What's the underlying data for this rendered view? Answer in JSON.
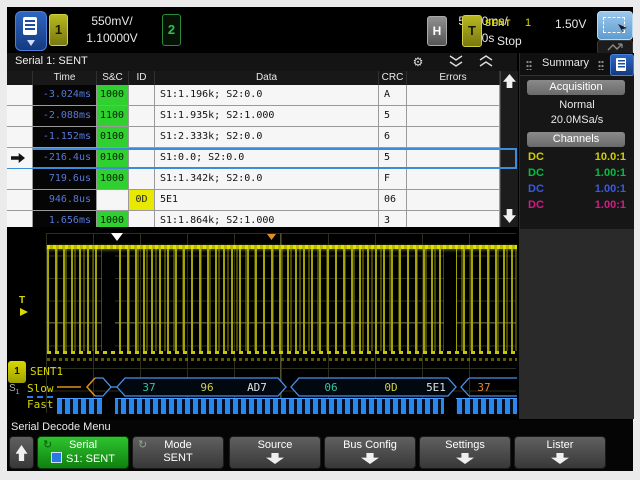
{
  "top_bar": {
    "ch1": {
      "label": "1",
      "scale": "550mV/",
      "position": "1.10000V"
    },
    "ch2": {
      "label": "2"
    },
    "horizontal": {
      "label": "H",
      "timebase": "5.000ms/",
      "delay": "0.0s"
    },
    "trigger": {
      "label": "T",
      "mode": "SENT",
      "source": "1",
      "level": "1.50V",
      "run_status": "Stop"
    }
  },
  "lister": {
    "title": "Serial 1: SENT",
    "columns": {
      "time": "Time",
      "sc": "S&C",
      "id": "ID",
      "data": "Data",
      "crc": "CRC",
      "errors": "Errors"
    },
    "rows": [
      {
        "time": "-3.024ms",
        "sc": "1000",
        "id": "",
        "data": "S1:1.196k; S2:0.0",
        "crc": "A",
        "errors": ""
      },
      {
        "time": "-2.088ms",
        "sc": "1100",
        "id": "",
        "data": "S1:1.935k; S2:1.000",
        "crc": "5",
        "errors": ""
      },
      {
        "time": "-1.152ms",
        "sc": "0100",
        "id": "",
        "data": "S1:2.333k; S2:0.0",
        "crc": "6",
        "errors": ""
      },
      {
        "time": "-216.4us",
        "sc": "0100",
        "id": "",
        "data": "S1:0.0; S2:0.0",
        "crc": "5",
        "errors": ""
      },
      {
        "time": "719.6us",
        "sc": "1000",
        "id": "",
        "data": "S1:1.342k; S2:0.0",
        "crc": "F",
        "errors": ""
      },
      {
        "time": "946.8us",
        "sc": "",
        "id": "0D",
        "data": "5E1",
        "crc": "06",
        "errors": ""
      },
      {
        "time": "1.656ms",
        "sc": "1000",
        "id": "",
        "data": "S1:1.864k; S2:1.000",
        "crc": "3",
        "errors": ""
      }
    ],
    "selected_row_index": 3,
    "gear_glyph": "⚙"
  },
  "summary": {
    "title": "Summary",
    "acquisition_label": "Acquisition",
    "acquisition_mode": "Normal",
    "sample_rate": "20.0MSa/s",
    "channels_label": "Channels",
    "channels": [
      {
        "coupling": "DC",
        "probe": "10.0:1",
        "color": "#d0d000"
      },
      {
        "coupling": "DC",
        "probe": "1.00:1",
        "color": "#00c040"
      },
      {
        "coupling": "DC",
        "probe": "1.00:1",
        "color": "#3858e8"
      },
      {
        "coupling": "DC",
        "probe": "1.00:1",
        "color": "#d81888"
      }
    ]
  },
  "waveform": {
    "trigger_level_label": "T",
    "bus_source_label": "1",
    "bus_name": "SENT1",
    "serial_slot_label": "S",
    "serial_slot_sub": "1",
    "slow_label": "Slow",
    "fast_label": "Fast",
    "slow_values": [
      {
        "text": "37",
        "color": "#30c8a0"
      },
      {
        "text": "96",
        "color": "#d0d040"
      },
      {
        "text": "AD7",
        "color": "#e0e0e0"
      },
      {
        "text": "06",
        "color": "#30c8a0"
      },
      {
        "text": "0D",
        "color": "#d0d040"
      },
      {
        "text": "5E1",
        "color": "#e0e0e0"
      },
      {
        "text": "37",
        "color": "#e08838"
      }
    ]
  },
  "decode_menu": {
    "title": "Serial Decode Menu",
    "serial": {
      "label": "Serial",
      "value": "S1: SENT"
    },
    "mode": {
      "label": "Mode",
      "value": "SENT"
    },
    "source": {
      "label": "Source"
    },
    "bus_config": {
      "label": "Bus Config"
    },
    "settings": {
      "label": "Settings"
    },
    "lister": {
      "label": "Lister"
    }
  },
  "icons": [
    "main-menu-icon",
    "gear-icon",
    "collapse-icon",
    "expand-icon",
    "rect-select-icon",
    "pan-zoom-icon",
    "scroll-up-icon",
    "scroll-down-icon",
    "cycle-icon",
    "checkbox-icon",
    "dropdown-arrow-icon",
    "back-up-icon"
  ],
  "colors": {
    "accent_blue": "#2b66c4",
    "channel1_yellow": "#d8d800",
    "channel2_green": "#00c040",
    "bus_blue": "#2888f0",
    "selected_row": "#3c8cd8",
    "sc_green": "#2fd02f",
    "id_yellow": "#e8e800",
    "time_blue": "#5878d8"
  }
}
